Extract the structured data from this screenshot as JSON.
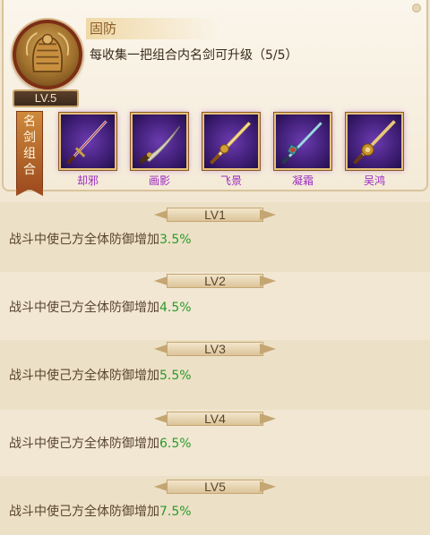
{
  "skill": {
    "name": "固防",
    "description": "每收集一把组合内名剑可升级（5/5）",
    "level_badge": "LV.5",
    "icon": "shield-armor-emblem"
  },
  "sword_set": {
    "label_chars": [
      "名",
      "剑",
      "组",
      "合"
    ],
    "swords": [
      {
        "name": "却邪",
        "icon": "sword-quexie-icon"
      },
      {
        "name": "画影",
        "icon": "sword-huaying-icon"
      },
      {
        "name": "飞景",
        "icon": "sword-feijing-icon"
      },
      {
        "name": "凝霜",
        "icon": "sword-ningshuang-icon"
      },
      {
        "name": "吴鸿",
        "icon": "sword-wuhong-icon"
      }
    ]
  },
  "levels": [
    {
      "label": "LV1",
      "text": "战斗中使己方全体防御增加",
      "value": "3.5%"
    },
    {
      "label": "LV2",
      "text": "战斗中使己方全体防御增加",
      "value": "4.5%"
    },
    {
      "label": "LV3",
      "text": "战斗中使己方全体防御增加",
      "value": "5.5%"
    },
    {
      "label": "LV4",
      "text": "战斗中使己方全体防御增加",
      "value": "6.5%"
    },
    {
      "label": "LV5",
      "text": "战斗中使己方全体防御增加",
      "value": "7.5%"
    }
  ],
  "colors": {
    "accent_green": "#2c9a2a",
    "sword_name": "#9c2ac2",
    "title": "#8a5a22"
  }
}
